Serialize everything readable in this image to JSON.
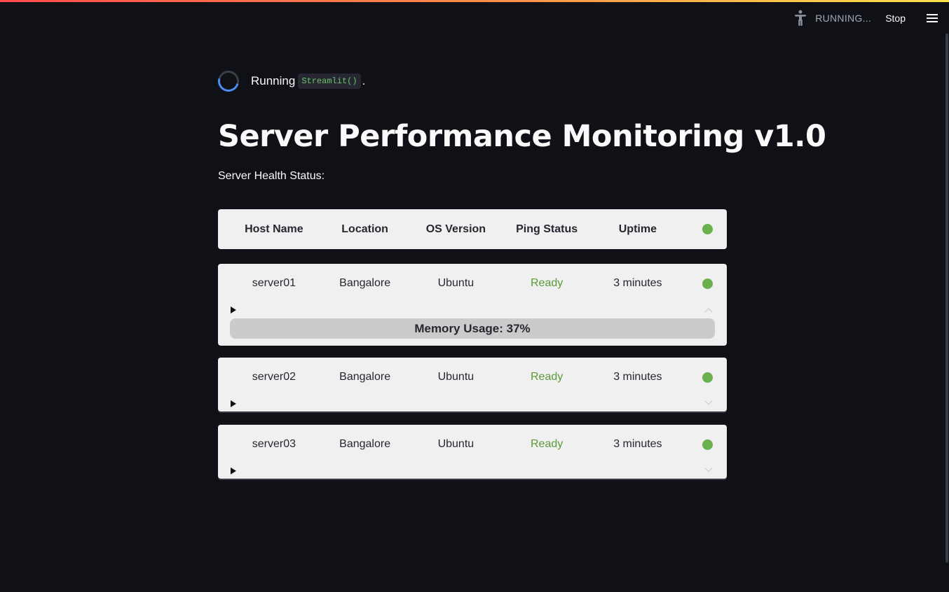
{
  "app": {
    "status_text": "RUNNING...",
    "stop_label": "Stop",
    "running_word": "Running",
    "running_code": "Streamlit()",
    "running_suffix": "."
  },
  "page": {
    "title": "Server Performance Monitoring v1.0",
    "subtitle": "Server Health Status:"
  },
  "table": {
    "headers": [
      "Host Name",
      "Location",
      "OS Version",
      "Ping Status",
      "Uptime"
    ],
    "rows": [
      {
        "host": "server01",
        "location": "Bangalore",
        "os": "Ubuntu",
        "ping": "Ready",
        "uptime": "3 minutes",
        "expanded": true,
        "memory_label": "Memory Usage: 37%",
        "memory_fraction": 0.37
      },
      {
        "host": "server02",
        "location": "Bangalore",
        "os": "Ubuntu",
        "ping": "Ready",
        "uptime": "3 minutes",
        "expanded": false
      },
      {
        "host": "server03",
        "location": "Bangalore",
        "os": "Ubuntu",
        "ping": "Ready",
        "uptime": "3 minutes",
        "expanded": false
      }
    ]
  },
  "icons": {
    "accessibility": "accessibility-icon",
    "menu": "hamburger-menu-icon",
    "spinner": "loading-spinner-icon",
    "status_dot": "status-dot-icon",
    "expand": "play-triangle-icon"
  },
  "colors": {
    "background": "#0f1117",
    "card": "#f0f0f0",
    "ready": "#5a9a38",
    "status_dot": "#6ab04c",
    "spinner_accent": "#4a8df6",
    "code_text": "#6bc46b"
  }
}
